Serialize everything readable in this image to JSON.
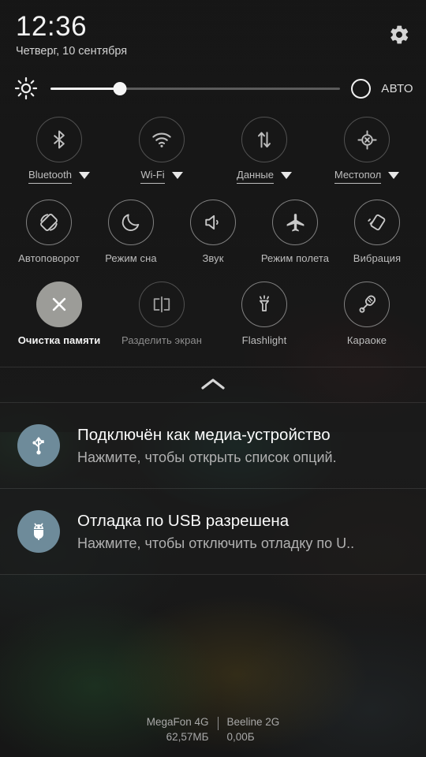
{
  "header": {
    "clock": "12:36",
    "date": "Четверг, 10 сентября",
    "settings_icon": "gear-icon"
  },
  "brightness": {
    "icon": "sun-icon",
    "value_percent": 24,
    "auto_label": "АВТО",
    "auto_enabled": false
  },
  "tiles": {
    "row1": [
      {
        "label": "Bluetooth",
        "icon": "bluetooth-icon",
        "state": "off",
        "has_caret": true
      },
      {
        "label": "Wi-Fi",
        "icon": "wifi-icon",
        "state": "off",
        "has_caret": true
      },
      {
        "label": "Данные",
        "icon": "mobile-data-icon",
        "state": "off",
        "has_caret": true
      },
      {
        "label": "Местопол",
        "icon": "location-off-icon",
        "state": "off",
        "has_caret": true
      }
    ],
    "row2": [
      {
        "label": "Автоповорот",
        "icon": "auto-rotate-icon",
        "state": "off"
      },
      {
        "label": "Режим сна",
        "icon": "moon-icon",
        "state": "off"
      },
      {
        "label": "Звук",
        "icon": "speaker-icon",
        "state": "off"
      },
      {
        "label": "Режим полета",
        "icon": "airplane-icon",
        "state": "off"
      },
      {
        "label": "Вибрация",
        "icon": "vibration-icon",
        "state": "off"
      }
    ],
    "row3": [
      {
        "label": "Очистка памяти",
        "icon": "close-x-icon",
        "state": "active"
      },
      {
        "label": "Разделить экран",
        "icon": "split-screen-icon",
        "state": "disabled"
      },
      {
        "label": "Flashlight",
        "icon": "flashlight-icon",
        "state": "off"
      },
      {
        "label": "Караоке",
        "icon": "microphone-icon",
        "state": "off"
      }
    ]
  },
  "handle": {
    "icon": "chevron-up-icon"
  },
  "notifications": [
    {
      "icon": "usb-icon",
      "title": "Подключён как медиа-устройство",
      "subtitle": "Нажмите, чтобы открыть список опций."
    },
    {
      "icon": "android-debug-icon",
      "title": "Отладка по USB разрешена",
      "subtitle": "Нажмите, чтобы отключить отладку по U.."
    }
  ],
  "footer": {
    "sim1": {
      "carrier": "MegaFon 4G",
      "usage": "62,57МБ"
    },
    "sim2": {
      "carrier": "Beeline 2G",
      "usage": "0,00Б"
    }
  },
  "colors": {
    "panel_bg": "#1d1d1d",
    "text_primary": "#f2f2f2",
    "text_secondary": "#b0b0b0",
    "tile_active": "#9c9c98",
    "notif_icon_bg": "#6e8b9a"
  }
}
